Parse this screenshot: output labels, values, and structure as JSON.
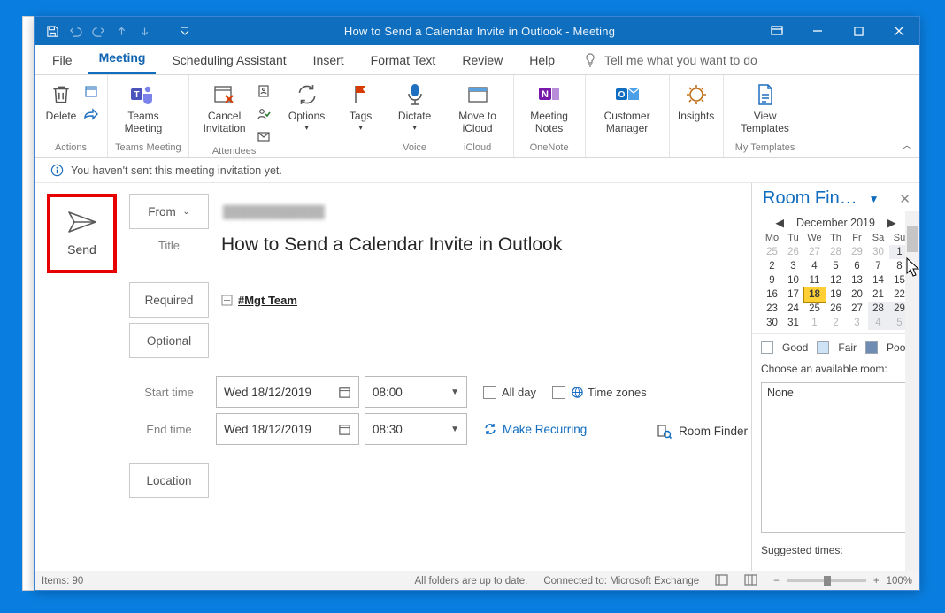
{
  "titlebar": {
    "title": "How to Send a Calendar Invite in Outlook  -  Meeting"
  },
  "tabs": {
    "file": "File",
    "meeting": "Meeting",
    "scheduling": "Scheduling Assistant",
    "insert": "Insert",
    "format": "Format Text",
    "review": "Review",
    "help": "Help",
    "tellme": "Tell me what you want to do"
  },
  "ribbon": {
    "delete": "Delete",
    "actions_label": "Actions",
    "teams": "Teams Meeting",
    "teams_label": "Teams Meeting",
    "cancel": "Cancel Invitation",
    "attendees_label": "Attendees",
    "options": "Options",
    "tags": "Tags",
    "dictate": "Dictate",
    "voice_label": "Voice",
    "movecloud": "Move to iCloud",
    "icloud_label": "iCloud",
    "notes": "Meeting Notes",
    "onenote_label": "OneNote",
    "custmgr": "Customer Manager",
    "insights": "Insights",
    "viewtmpl": "View Templates",
    "mytmpl_label": "My Templates"
  },
  "infobar": {
    "text": "You haven't sent this meeting invitation yet."
  },
  "form": {
    "send": "Send",
    "from_label": "From",
    "from_value": "████████████",
    "title_label": "Title",
    "title_value": "How to Send a Calendar Invite in Outlook",
    "required_label": "Required",
    "required_value": "#Mgt Team",
    "optional_label": "Optional",
    "start_label": "Start time",
    "start_date": "Wed 18/12/2019",
    "start_time": "08:00",
    "end_label": "End time",
    "end_date": "Wed 18/12/2019",
    "end_time": "08:30",
    "allday": "All day",
    "timezones": "Time zones",
    "recurring": "Make Recurring",
    "location_label": "Location",
    "roomfinder_btn": "Room Finder"
  },
  "side": {
    "title": "Room Fin…",
    "month": "December 2019",
    "dow": [
      "Mo",
      "Tu",
      "We",
      "Th",
      "Fr",
      "Sa",
      "Su"
    ],
    "weeks": [
      [
        {
          "d": "25",
          "m": 1
        },
        {
          "d": "26",
          "m": 1
        },
        {
          "d": "27",
          "m": 1
        },
        {
          "d": "28",
          "m": 1
        },
        {
          "d": "29",
          "m": 1
        },
        {
          "d": "30",
          "m": 1
        },
        {
          "d": "1",
          "s": 1
        }
      ],
      [
        {
          "d": "2"
        },
        {
          "d": "3"
        },
        {
          "d": "4"
        },
        {
          "d": "5"
        },
        {
          "d": "6"
        },
        {
          "d": "7"
        },
        {
          "d": "8"
        }
      ],
      [
        {
          "d": "9"
        },
        {
          "d": "10"
        },
        {
          "d": "11"
        },
        {
          "d": "12"
        },
        {
          "d": "13"
        },
        {
          "d": "14"
        },
        {
          "d": "15"
        }
      ],
      [
        {
          "d": "16"
        },
        {
          "d": "17"
        },
        {
          "d": "18",
          "hl": 1
        },
        {
          "d": "19"
        },
        {
          "d": "20"
        },
        {
          "d": "21"
        },
        {
          "d": "22"
        }
      ],
      [
        {
          "d": "23"
        },
        {
          "d": "24"
        },
        {
          "d": "25"
        },
        {
          "d": "26"
        },
        {
          "d": "27"
        },
        {
          "d": "28",
          "s": 1
        },
        {
          "d": "29",
          "s": 1
        }
      ],
      [
        {
          "d": "30"
        },
        {
          "d": "31"
        },
        {
          "d": "1",
          "m": 1
        },
        {
          "d": "2",
          "m": 1
        },
        {
          "d": "3",
          "m": 1
        },
        {
          "d": "4",
          "m": 1,
          "s": 1
        },
        {
          "d": "5",
          "m": 1,
          "s": 1
        }
      ]
    ],
    "legend": {
      "good": "Good",
      "fair": "Fair",
      "poor": "Poor"
    },
    "choose_label": "Choose an available room:",
    "room_value": "None",
    "suggested_label": "Suggested times:"
  },
  "status": {
    "items": "Items: 90",
    "folders": "All folders are up to date.",
    "connected": "Connected to: Microsoft Exchange",
    "zoom": "100%"
  }
}
